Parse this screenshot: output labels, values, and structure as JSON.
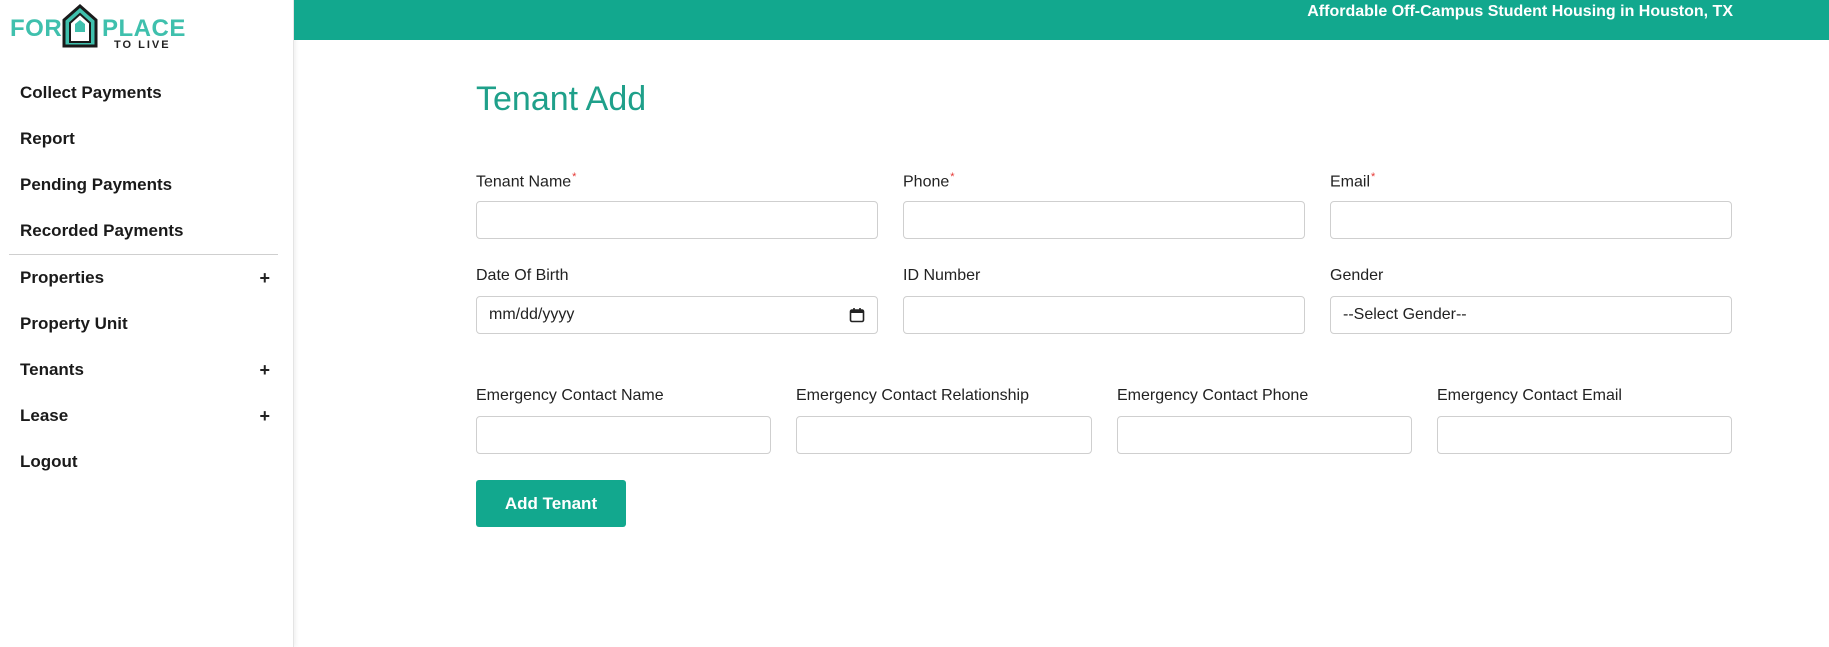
{
  "brand": {
    "logo_for": "FOR",
    "logo_place": "PLACE",
    "logo_to_live": "TO LIVE",
    "accent_color": "#12a88e",
    "logo_color": "#3fc0ad",
    "logo_icon": "house-icon"
  },
  "topbar": {
    "tagline": "Affordable Off-Campus Student Housing in Houston, TX"
  },
  "sidebar": {
    "items": [
      {
        "label": "Collect Payments"
      },
      {
        "label": "Report"
      },
      {
        "label": "Pending Payments"
      },
      {
        "label": "Recorded Payments"
      },
      {
        "label": "Properties",
        "expand": "+"
      },
      {
        "label": "Property Unit"
      },
      {
        "label": "Tenants",
        "expand": "+"
      },
      {
        "label": "Lease",
        "expand": "+"
      },
      {
        "label": "Logout"
      }
    ]
  },
  "main": {
    "title": "Tenant Add",
    "fields": {
      "tenant_name": {
        "label": "Tenant Name",
        "required": "*",
        "value": ""
      },
      "phone": {
        "label": "Phone",
        "required": "*",
        "value": ""
      },
      "email": {
        "label": "Email",
        "required": "*",
        "value": ""
      },
      "dob": {
        "label": "Date Of Birth",
        "value": "mm/dd/yyyy",
        "icon": "calendar-icon"
      },
      "id_number": {
        "label": "ID Number",
        "value": ""
      },
      "gender": {
        "label": "Gender",
        "selected": "--Select Gender--"
      },
      "ec_name": {
        "label": "Emergency Contact Name",
        "value": ""
      },
      "ec_relationship": {
        "label": "Emergency Contact Relationship",
        "value": ""
      },
      "ec_phone": {
        "label": "Emergency Contact Phone",
        "value": ""
      },
      "ec_email": {
        "label": "Emergency Contact Email",
        "value": ""
      }
    },
    "submit_label": "Add Tenant"
  }
}
